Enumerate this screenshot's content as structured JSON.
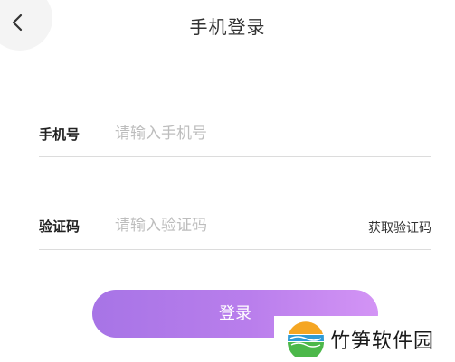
{
  "header": {
    "title": "手机登录",
    "back_icon": "chevron-left-icon"
  },
  "form": {
    "phone": {
      "label": "手机号",
      "placeholder": "请输入手机号",
      "value": ""
    },
    "code": {
      "label": "验证码",
      "placeholder": "请输入验证码",
      "value": "",
      "get_code_label": "获取验证码"
    },
    "submit_label": "登录"
  },
  "watermark": {
    "text": "竹笋软件园"
  },
  "colors": {
    "button_gradient_start": "#a774e6",
    "button_gradient_end": "#d394f5",
    "placeholder": "#bdbdbd",
    "divider": "#dcdcdc"
  }
}
